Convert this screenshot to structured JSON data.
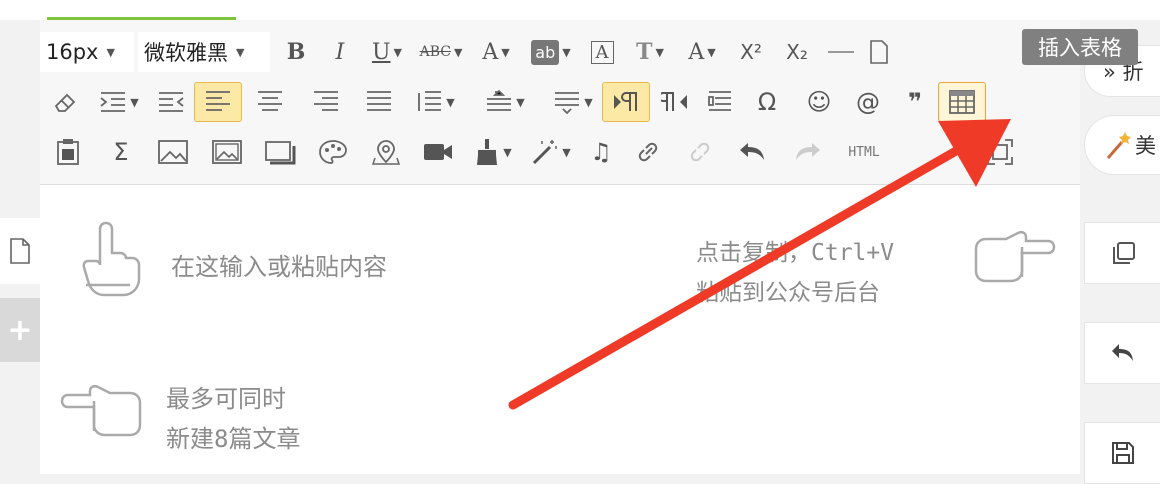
{
  "toolbar": {
    "font_size": "16px",
    "font_family": "微软雅黑",
    "bold": "B",
    "italic": "I",
    "underline": "U",
    "strike": "ABC",
    "font_color": "A",
    "bg_color": "ab",
    "border_text": "A",
    "text_style": "T",
    "char_spacing": "A",
    "superscript": "X²",
    "subscript": "X₂",
    "omega": "Ω",
    "at": "@",
    "quote": "❞",
    "sigma": "Σ",
    "html": "HTML"
  },
  "tooltip": {
    "text": "插入表格"
  },
  "right_panel": {
    "fold_label": "» 折",
    "beautify_label": "美"
  },
  "content": {
    "hint_top_left": "在这输入或粘贴内容",
    "hint_top_right_line1": "点击复制，Ctrl+V",
    "hint_top_right_line2": "粘贴到公众号后台",
    "hint_bottom_line1": "最多可同时",
    "hint_bottom_line2": "新建8篇文章"
  },
  "colors": {
    "accent_green": "#7ec43c",
    "arrow_red": "#f03a28",
    "active_bg": "#fde9a6"
  }
}
